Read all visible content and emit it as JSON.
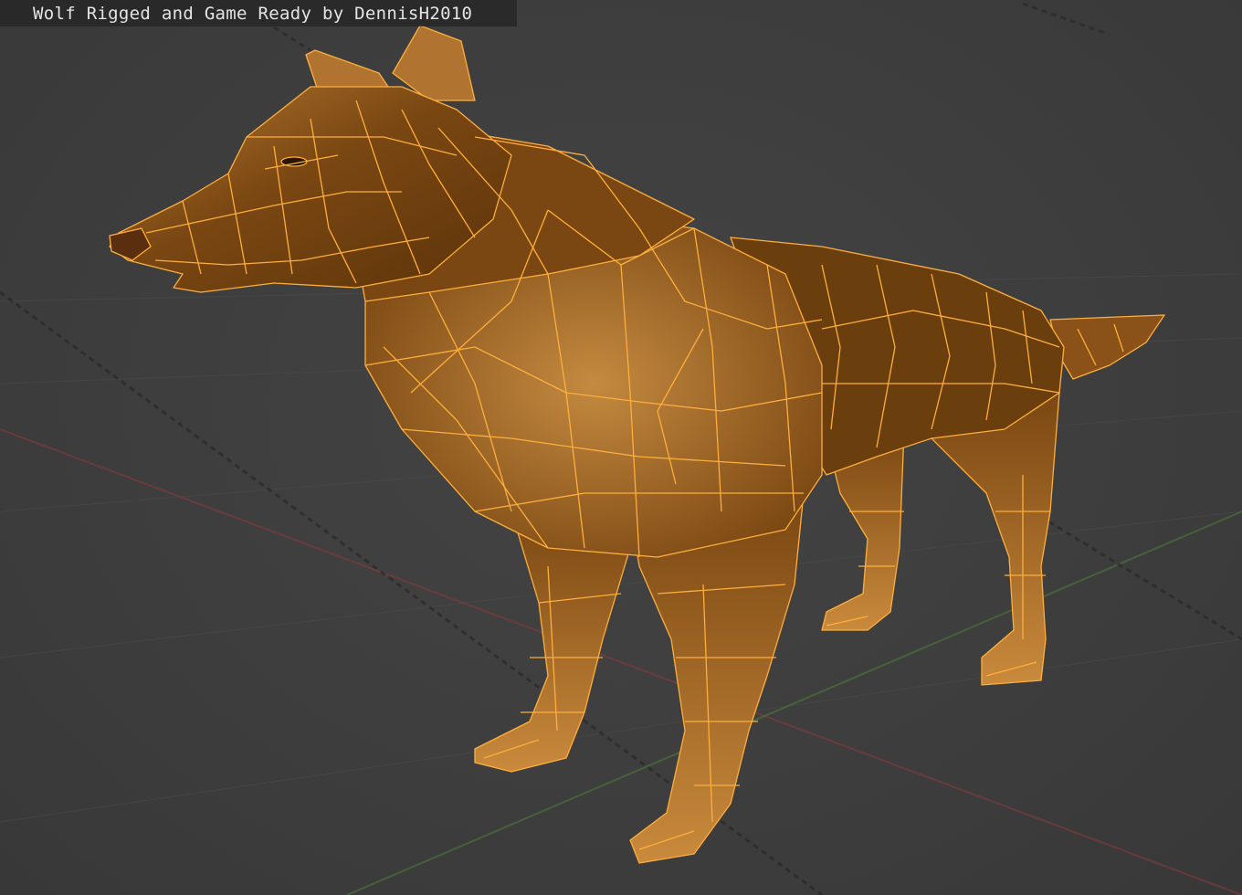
{
  "viewport": {
    "title": "Wolf Rigged and Game Ready by DennisH2010",
    "model_icon": "wolf-mesh",
    "colors": {
      "background": "#3d3d3d",
      "x_axis": "#8a3b3b",
      "y_axis": "#4c7a3a",
      "wire": "#ffae3c",
      "fur_dark": "#6b3e0e",
      "fur_light": "#c98a3c"
    }
  }
}
